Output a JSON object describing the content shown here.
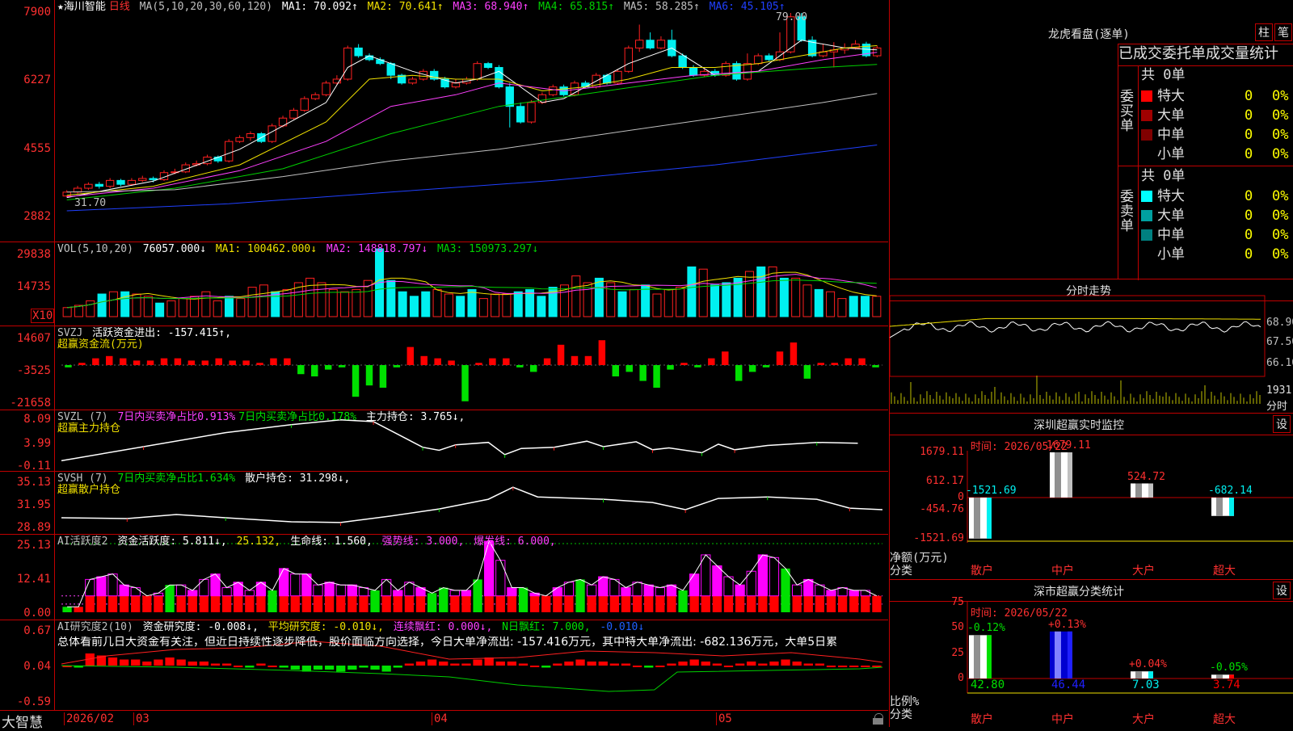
{
  "colors": {
    "up": "#ff2020",
    "down": "#00f0f0",
    "grid": "#c00000",
    "ma1": "#ffffff",
    "ma2": "#f0e000",
    "ma3": "#ff40ff",
    "ma4": "#00d000",
    "ma5": "#c0c0c0",
    "ma6": "#2040ff",
    "green": "#00e000",
    "magenta": "#ff00ff"
  },
  "k": {
    "title": "★海川智能",
    "period": "日线",
    "ma_def": "MA(5,10,20,30,60,120)",
    "ma1": "MA1: 70.092↑",
    "ma2": "MA2: 70.641↑",
    "ma3": "MA3: 68.940↑",
    "ma4": "MA4: 65.815↑",
    "ma5": "MA5: 58.285↑",
    "ma6": "MA6: 45.105↑",
    "ticks": [
      "7900",
      "6227",
      "4555",
      "2882"
    ],
    "high_label": "79.00",
    "low_label": "31.70",
    "candles": [
      [
        32,
        33,
        31.7,
        33.5
      ],
      [
        33,
        34,
        32.6,
        34.6
      ],
      [
        34,
        35,
        33.6,
        35.5
      ],
      [
        35,
        34.5,
        33.9,
        35.6
      ],
      [
        34.5,
        36,
        34,
        36.6
      ],
      [
        36,
        35,
        34.5,
        36.4
      ],
      [
        35,
        36,
        34.6,
        36.6
      ],
      [
        36,
        36.5,
        35.6,
        37.2
      ],
      [
        36.5,
        36.2,
        35.5,
        37
      ],
      [
        36.2,
        38,
        35.9,
        38.6
      ],
      [
        38,
        38.2,
        37.6,
        39
      ],
      [
        38.2,
        40,
        37.9,
        40.6
      ],
      [
        40,
        40.3,
        39.6,
        41.1
      ],
      [
        40.3,
        42,
        39.9,
        42.6
      ],
      [
        42,
        41,
        40.5,
        42.4
      ],
      [
        41,
        46,
        40.6,
        46.6
      ],
      [
        46,
        47,
        45.6,
        47.6
      ],
      [
        47,
        48,
        46.2,
        48.6
      ],
      [
        48,
        46,
        45.6,
        48.4
      ],
      [
        46,
        50,
        45.6,
        50.6
      ],
      [
        50,
        52,
        49.6,
        52.6
      ],
      [
        52,
        54,
        51.6,
        54.6
      ],
      [
        54,
        57,
        53.6,
        57.6
      ],
      [
        57,
        58,
        56.6,
        58.6
      ],
      [
        58,
        61,
        57.6,
        61.6
      ],
      [
        61,
        62,
        60.6,
        63
      ],
      [
        62,
        70,
        61.6,
        70.6
      ],
      [
        70,
        68,
        67.5,
        71
      ],
      [
        68,
        67,
        66.6,
        68.6
      ],
      [
        67,
        66,
        65.6,
        67.6
      ],
      [
        66,
        63,
        62,
        66.4
      ],
      [
        63,
        61,
        60.6,
        63.4
      ],
      [
        61,
        62,
        60.6,
        62.6
      ],
      [
        62,
        64,
        61.6,
        64.6
      ],
      [
        64,
        62,
        61.6,
        64.6
      ],
      [
        62,
        60,
        59.6,
        62.6
      ],
      [
        60,
        61,
        59.6,
        62
      ],
      [
        61,
        62,
        60.6,
        62.6
      ],
      [
        62,
        66,
        61.6,
        66.6
      ],
      [
        66,
        65,
        64.6,
        66.4
      ],
      [
        65,
        60,
        59.6,
        65.6
      ],
      [
        60,
        55,
        49.6,
        61
      ],
      [
        55,
        51,
        50.6,
        56
      ],
      [
        51,
        56,
        50.6,
        56.6
      ],
      [
        56,
        58,
        55.6,
        58.6
      ],
      [
        58,
        60,
        57.6,
        60.6
      ],
      [
        60,
        58,
        57.6,
        60.6
      ],
      [
        58,
        61,
        57.6,
        61.6
      ],
      [
        61,
        60,
        59.6,
        61.6
      ],
      [
        60,
        63,
        59.6,
        63.6
      ],
      [
        63,
        61,
        60.6,
        63.4
      ],
      [
        61,
        64,
        60.6,
        64.6
      ],
      [
        64,
        70,
        63.6,
        70.6
      ],
      [
        70,
        72,
        69,
        76
      ],
      [
        72,
        70,
        69.6,
        74
      ],
      [
        70,
        72,
        69.6,
        73
      ],
      [
        72,
        68,
        67.6,
        74.7
      ],
      [
        68,
        65,
        64.6,
        68.6
      ],
      [
        65,
        63,
        62.6,
        65.6
      ],
      [
        63,
        64,
        62.6,
        64.6
      ],
      [
        64,
        63,
        62.6,
        64.6
      ],
      [
        63,
        66,
        62.6,
        66.6
      ],
      [
        66,
        62,
        61.6,
        66.6
      ],
      [
        62,
        66,
        61.6,
        68.6
      ],
      [
        66,
        68,
        65.6,
        68.6
      ],
      [
        68,
        67,
        66.6,
        68.6
      ],
      [
        67,
        69,
        66.6,
        74
      ],
      [
        69,
        78,
        68.6,
        79
      ],
      [
        78,
        72,
        71.6,
        79
      ],
      [
        72,
        68,
        67.6,
        73
      ],
      [
        68,
        69,
        67.6,
        71
      ],
      [
        69,
        69.5,
        65,
        71.5
      ],
      [
        69.5,
        70,
        68.5,
        71.2
      ],
      [
        70,
        71,
        69.6,
        72
      ],
      [
        71,
        68,
        67.6,
        71.6
      ],
      [
        68,
        70,
        67.6,
        70.6
      ]
    ],
    "ma_series": {
      "ma1": [
        [
          0,
          31.6
        ],
        [
          8,
          35.8
        ],
        [
          16,
          44
        ],
        [
          24,
          56
        ],
        [
          26,
          65
        ],
        [
          28,
          68
        ],
        [
          32,
          64
        ],
        [
          36,
          61
        ],
        [
          38,
          62
        ],
        [
          40,
          64
        ],
        [
          44,
          56
        ],
        [
          46,
          57
        ],
        [
          52,
          66
        ],
        [
          56,
          70
        ],
        [
          60,
          63
        ],
        [
          64,
          64
        ],
        [
          68,
          72
        ],
        [
          72,
          70
        ],
        [
          75,
          69.5
        ]
      ],
      "ma2": [
        [
          0,
          32.2
        ],
        [
          8,
          34.5
        ],
        [
          16,
          40
        ],
        [
          24,
          51
        ],
        [
          28,
          62
        ],
        [
          32,
          63
        ],
        [
          36,
          62
        ],
        [
          40,
          62
        ],
        [
          44,
          59
        ],
        [
          48,
          60
        ],
        [
          52,
          62
        ],
        [
          56,
          65
        ],
        [
          60,
          65
        ],
        [
          64,
          66
        ],
        [
          68,
          68
        ],
        [
          72,
          70
        ],
        [
          75,
          70.6
        ]
      ],
      "ma3": [
        [
          0,
          31.8
        ],
        [
          8,
          34
        ],
        [
          16,
          38.5
        ],
        [
          24,
          46
        ],
        [
          30,
          55
        ],
        [
          36,
          58
        ],
        [
          40,
          61
        ],
        [
          46,
          59
        ],
        [
          52,
          61
        ],
        [
          58,
          63
        ],
        [
          64,
          64
        ],
        [
          70,
          67
        ],
        [
          75,
          68.9
        ]
      ],
      "ma4": [
        [
          0,
          31
        ],
        [
          10,
          34
        ],
        [
          20,
          39
        ],
        [
          30,
          48
        ],
        [
          40,
          55
        ],
        [
          50,
          59
        ],
        [
          60,
          63
        ],
        [
          70,
          65
        ],
        [
          75,
          65.8
        ]
      ],
      "ma5": [
        [
          0,
          33
        ],
        [
          10,
          33.6
        ],
        [
          20,
          37
        ],
        [
          30,
          41
        ],
        [
          40,
          44
        ],
        [
          50,
          48
        ],
        [
          60,
          52
        ],
        [
          70,
          56
        ],
        [
          75,
          58.3
        ]
      ],
      "ma6": [
        [
          0,
          28.2
        ],
        [
          15,
          30
        ],
        [
          30,
          33
        ],
        [
          45,
          36
        ],
        [
          60,
          40
        ],
        [
          75,
          45.1
        ]
      ]
    }
  },
  "vol": {
    "hdr": "VOL(5,10,20)",
    "v": "76057.000↓",
    "ma1": "MA1: 100462.000↓",
    "ma2": "MA2: 148818.797↓",
    "ma3": "MA3: 150973.297↓",
    "ticks": [
      "29838",
      "14735"
    ],
    "x10": "X10",
    "bars": [
      4,
      5,
      7,
      10,
      11,
      11,
      10,
      9,
      6,
      7,
      8,
      9,
      11,
      7,
      9,
      8,
      13,
      14,
      11,
      12,
      15,
      17,
      15,
      12,
      11,
      12,
      16,
      30,
      16,
      11,
      9,
      11,
      12,
      10,
      9,
      12,
      8,
      10,
      10,
      11,
      12,
      9,
      13,
      14,
      18,
      15,
      17,
      15,
      11,
      12,
      14,
      10,
      12,
      13,
      22,
      21,
      14,
      15,
      17,
      20,
      22,
      22,
      17,
      17,
      14,
      12,
      11,
      8,
      9,
      9,
      9
    ]
  },
  "svzj": {
    "hdr1": "SVZJ",
    "hdr2": "活跃资金进出: -157.415↑,",
    "sub": "超赢资金流(万元)",
    "ticks": [
      "14607",
      "-3525",
      "-21658"
    ],
    "bars": [
      -1,
      1,
      3,
      4,
      3,
      2,
      2,
      3,
      3,
      2,
      2,
      3,
      2,
      2,
      1,
      3,
      3,
      -4,
      -5,
      -2,
      -1,
      -14,
      -9,
      -10,
      -1,
      8,
      4,
      3,
      2,
      -16,
      1,
      3,
      3,
      -1,
      -3,
      3,
      9,
      4,
      4,
      11,
      -5,
      -3,
      -7,
      -10,
      -2,
      1,
      -1,
      3,
      6,
      -7,
      -3,
      -1,
      6,
      10,
      -6,
      1,
      1,
      3,
      3,
      -1
    ]
  },
  "svzl": {
    "hdr1": "SVZL (7)",
    "hdr2": "7日内买卖净占比0.913%",
    "hdr3": "7日内买卖净占比0.178%",
    "hdr4": "主力持仓: 3.765↓,",
    "sub": "超赢主力持仓",
    "ticks": [
      "8.09",
      "3.99",
      "-0.11"
    ],
    "line": [
      [
        0,
        0.9
      ],
      [
        10,
        3.2
      ],
      [
        20,
        5.5
      ],
      [
        28,
        6.8
      ],
      [
        34,
        7.6
      ],
      [
        38,
        7.3
      ],
      [
        42,
        4.5
      ],
      [
        44,
        3.1
      ],
      [
        46,
        2.6
      ],
      [
        48,
        3.5
      ],
      [
        52,
        3.9
      ],
      [
        54,
        1.9
      ],
      [
        56,
        2.9
      ],
      [
        60,
        3.1
      ],
      [
        64,
        4.1
      ],
      [
        66,
        3.2
      ],
      [
        70,
        4.0
      ],
      [
        72,
        2.7
      ],
      [
        74,
        3.0
      ],
      [
        78,
        2.2
      ],
      [
        80,
        3.6
      ],
      [
        82,
        2.7
      ],
      [
        86,
        3.4
      ],
      [
        92,
        3.9
      ],
      [
        97,
        3.77
      ]
    ]
  },
  "svsh": {
    "hdr1": "SVSH (7)",
    "hdr2": "7日内买卖净占比1.634%",
    "hdr3": "散户持仓: 31.298↓,",
    "sub": "超赢散户持仓",
    "ticks": [
      "35.13",
      "31.95",
      "28.89"
    ],
    "line": [
      [
        0,
        30.2
      ],
      [
        8,
        30.1
      ],
      [
        14,
        30.6
      ],
      [
        20,
        30.2
      ],
      [
        28,
        29.7
      ],
      [
        34,
        29.6
      ],
      [
        40,
        30.4
      ],
      [
        46,
        31.3
      ],
      [
        52,
        32.5
      ],
      [
        55,
        34.0
      ],
      [
        58,
        32.8
      ],
      [
        66,
        32.5
      ],
      [
        72,
        32.1
      ],
      [
        76,
        31.2
      ],
      [
        80,
        32.6
      ],
      [
        86,
        32.8
      ],
      [
        92,
        32.5
      ],
      [
        96,
        31.4
      ],
      [
        100,
        31.2
      ]
    ]
  },
  "ai1": {
    "hdr1": "AI活跃度2",
    "hdr2": "资金活跃度: 5.811↓,",
    "hdr3": "25.132,",
    "hdr4": "生命线: 1.560,",
    "hdr5": "强势线: 3.000,",
    "hdr6": "爆发线: 6.000,",
    "ticks": [
      "25.13",
      "12.41",
      "0.00"
    ],
    "bars": [
      2,
      2,
      12,
      13,
      14,
      10,
      9,
      6,
      7,
      10,
      10,
      8,
      12,
      14,
      9,
      11,
      8,
      11,
      8,
      16,
      14,
      14,
      10,
      11,
      10,
      10,
      9,
      8,
      12,
      8,
      11,
      9,
      7,
      9,
      8,
      8,
      12,
      26,
      19,
      9,
      9,
      7,
      6,
      9,
      11,
      12,
      10,
      13,
      12,
      9,
      11,
      10,
      9,
      10,
      8,
      14,
      21,
      17,
      13,
      10,
      15,
      21,
      20,
      16,
      10,
      12,
      10,
      8,
      9,
      8,
      8,
      6
    ]
  },
  "ai2": {
    "hdr1": "AI研究度2(10)",
    "hdr2": "资金研究度: -0.008↓,",
    "hdr3": "平均研究度: -0.010↓,",
    "hdr4": "连续飘红: 0.000↓,",
    "hdr5": "N日飘红: 7.000,",
    "hdr6": "-0.010↓",
    "note": "总体看前几日大资金有关注，但近日持续性逐步降低，股价面临方向选择，今日大单净流出: -157.416万元，其中特大单净流出: -682.136万元，大单5日累",
    "ticks": [
      "0.67",
      "0.04",
      "-0.59"
    ]
  },
  "bottom": {
    "brand": "大智慧",
    "dates": [
      "2026/02",
      "03",
      "04",
      "05"
    ]
  },
  "lhb": {
    "title": "龙虎看盘(逐单)",
    "btn1": "柱",
    "btn2": "笔",
    "sub": "已成交委托单成交量统计",
    "buy": "委买单",
    "sell": "委卖单",
    "total_buy": "共 0单",
    "total_sell": "共 0单",
    "buy_rows": [
      {
        "label": "特大",
        "val": "0",
        "pct": "0%",
        "color": "#ff0000"
      },
      {
        "label": "大单",
        "val": "0",
        "pct": "0%",
        "color": "#a00000"
      },
      {
        "label": "中单",
        "val": "0",
        "pct": "0%",
        "color": "#800000"
      },
      {
        "label": "小单",
        "val": "0",
        "pct": "0%",
        "color": ""
      }
    ],
    "sell_rows": [
      {
        "label": "特大",
        "val": "0",
        "pct": "0%",
        "color": "#00ffff"
      },
      {
        "label": "大单",
        "val": "0",
        "pct": "0%",
        "color": "#00a0a0"
      },
      {
        "label": "中单",
        "val": "0",
        "pct": "0%",
        "color": "#008080"
      },
      {
        "label": "小单",
        "val": "0",
        "pct": "0%",
        "color": ""
      }
    ]
  },
  "fs": {
    "title": "分时走势",
    "t1": "68.90",
    "t2": "67.50",
    "t3": "66.10",
    "t4": "1931",
    "t5": "分时"
  },
  "sz": {
    "title": "深圳超赢实时监控",
    "btn": "设",
    "time": "时间: 2026/05/22",
    "ticks": [
      "1679.11",
      "612.17",
      "0",
      "-454.76",
      "-1521.69"
    ],
    "ylabel1": "净额(万元)",
    "ylabel2": "分类",
    "cats": [
      "散户",
      "中户",
      "大户",
      "超大"
    ],
    "vals": [
      -1521.69,
      1679.11,
      524.72,
      -682.14
    ],
    "labels": [
      "-1521.69",
      "1679.11",
      "524.72",
      "-682.14"
    ]
  },
  "ss": {
    "title": "深市超赢分类统计",
    "btn": "设",
    "time": "时间: 2026/05/22",
    "ticks": [
      "75",
      "50",
      "25",
      "0"
    ],
    "ylabel1": "比例%",
    "ylabel2": "分类",
    "cats": [
      "散户",
      "中户",
      "大户",
      "超大"
    ],
    "vals": [
      42.8,
      46.44,
      7.03,
      3.74
    ],
    "vlabels": [
      "42.80",
      "46.44",
      "7.03",
      "3.74"
    ],
    "chg": [
      "-0.12%",
      "+0.13%",
      "+0.04%",
      "-0.05%"
    ]
  }
}
